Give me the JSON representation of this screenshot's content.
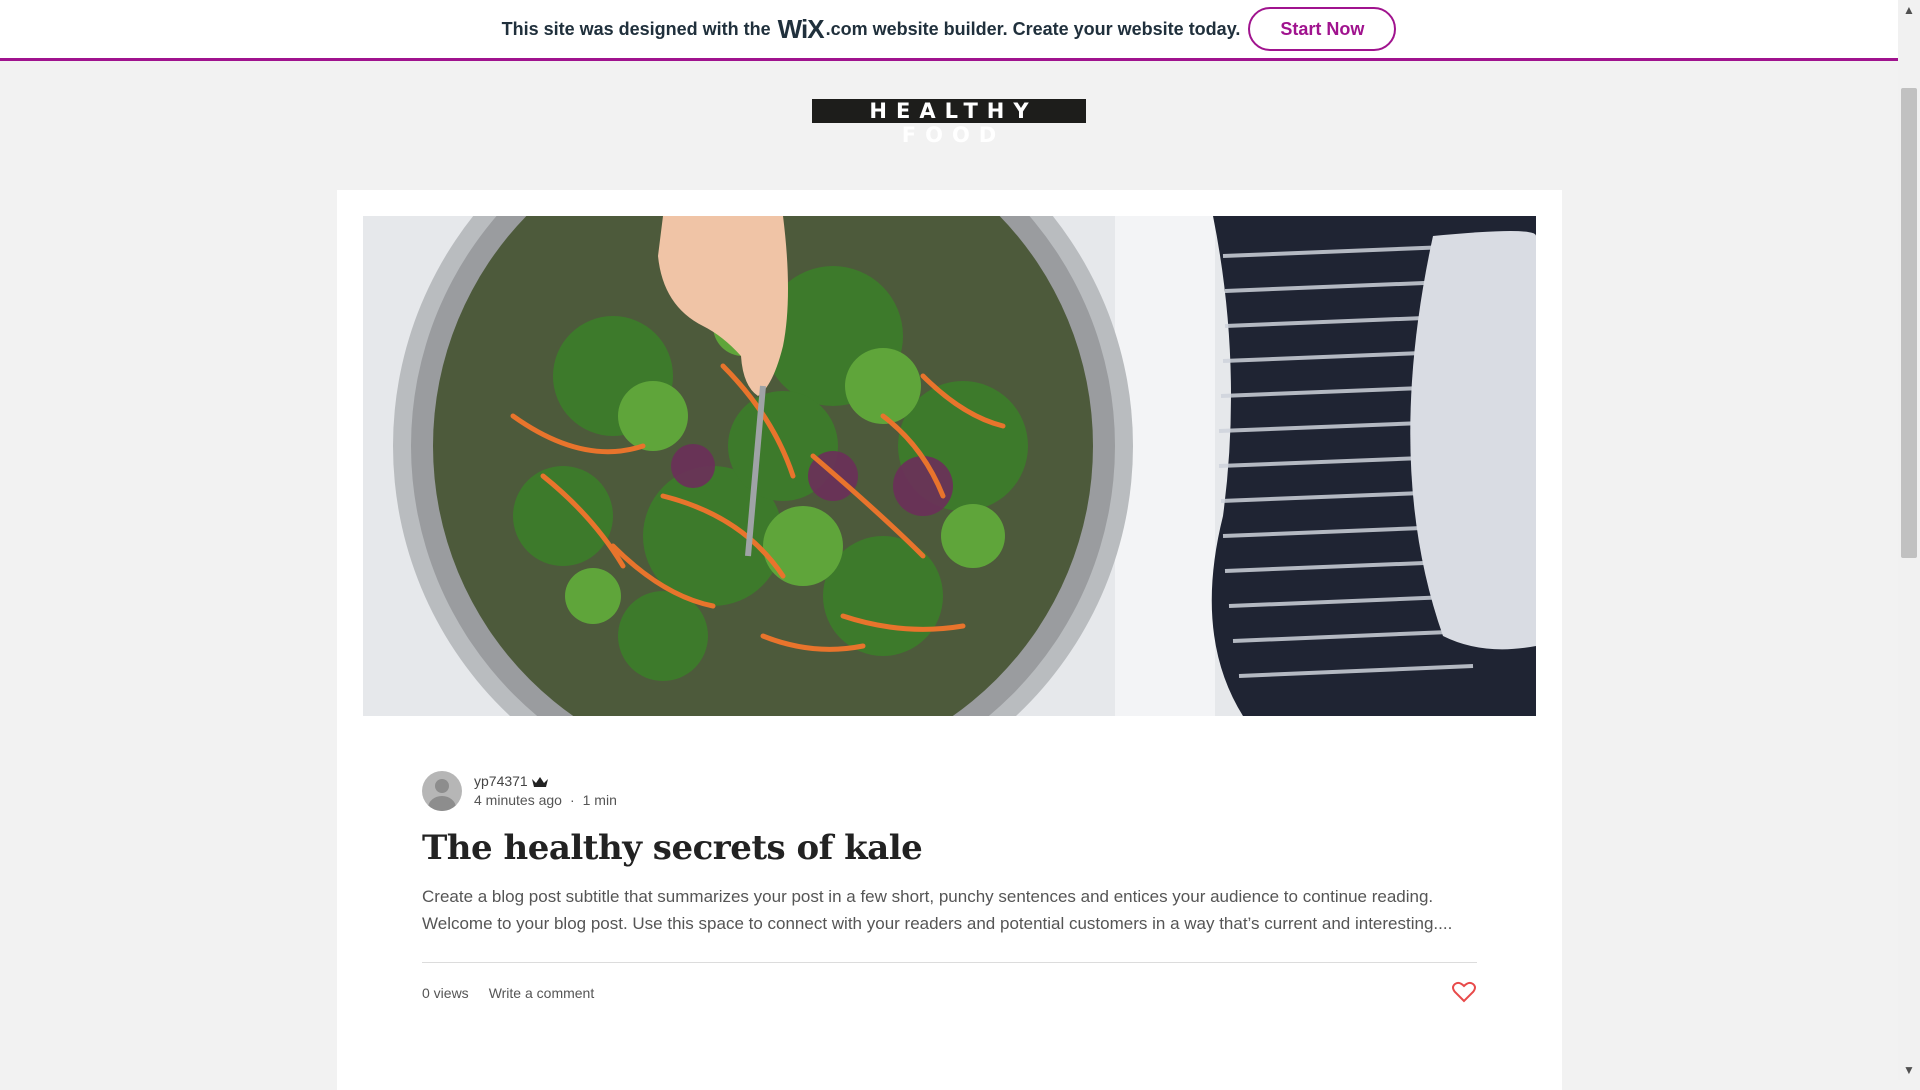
{
  "banner": {
    "text_before": "This site was designed with the",
    "wix_logo": "WiX",
    "wix_domain": ".com",
    "text_after": "website builder. Create your website today.",
    "cta_label": "Start Now",
    "accent_color": "#a0138e"
  },
  "site": {
    "title": "HEALTHY FOOD"
  },
  "post": {
    "author": "yp74371",
    "author_badge_icon": "crown-icon",
    "time_ago": "4 minutes ago",
    "separator": "·",
    "read_time": "1 min",
    "title": "The healthy secrets of kale",
    "excerpt_line1": "Create a blog post subtitle that summarizes your post in a few short, punchy sentences and entices your audience to continue reading.",
    "excerpt_line2": "Welcome to your blog post. Use this space to connect with your readers and potential customers in a way that’s current and interesting....",
    "views": "0 views",
    "comment_label": "Write a comment",
    "like_icon": "heart-icon",
    "like_color": "#e84a4a"
  }
}
